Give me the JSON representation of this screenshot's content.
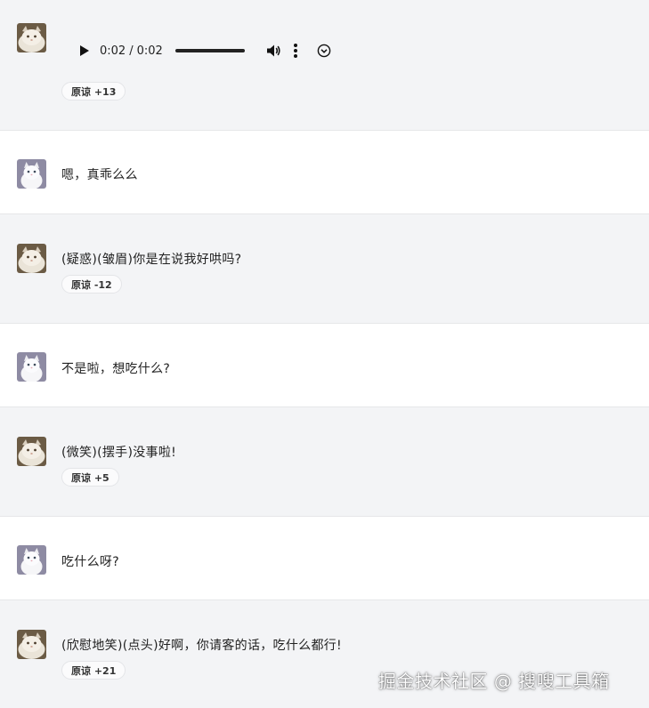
{
  "audio": {
    "current_time": "0:02",
    "separator": "/",
    "duration": "0:02",
    "progress": 1.0,
    "icons": [
      "play-icon",
      "volume-icon",
      "more-options-icon",
      "download-icon"
    ]
  },
  "messages": [
    {
      "role": "ai",
      "avatar": "fluffy-cat-avatar",
      "type": "audio",
      "badge": "原谅 +13"
    },
    {
      "role": "user",
      "avatar": "white-cat-avatar",
      "text": "嗯，真乖么么"
    },
    {
      "role": "ai",
      "avatar": "fluffy-cat-avatar",
      "text": "(疑惑)(皱眉)你是在说我好哄吗?",
      "badge": "原谅 -12"
    },
    {
      "role": "user",
      "avatar": "white-cat-avatar",
      "text": "不是啦，想吃什么?"
    },
    {
      "role": "ai",
      "avatar": "fluffy-cat-avatar",
      "text": "(微笑)(摆手)没事啦!",
      "badge": "原谅 +5"
    },
    {
      "role": "user",
      "avatar": "white-cat-avatar",
      "text": "吃什么呀?"
    },
    {
      "role": "ai",
      "avatar": "fluffy-cat-avatar",
      "text": "(欣慰地笑)(点头)好啊，你请客的话，吃什么都行!",
      "badge": "原谅 +21"
    }
  ],
  "watermark": "掘金技术社区 @ 搜嗖工具箱",
  "colors": {
    "ai_row_bg": "#f3f4f6",
    "user_row_bg": "#ffffff",
    "divider": "#e6e7e9",
    "badge_bg": "#fbfbfc",
    "badge_border": "#e4e5e8"
  }
}
